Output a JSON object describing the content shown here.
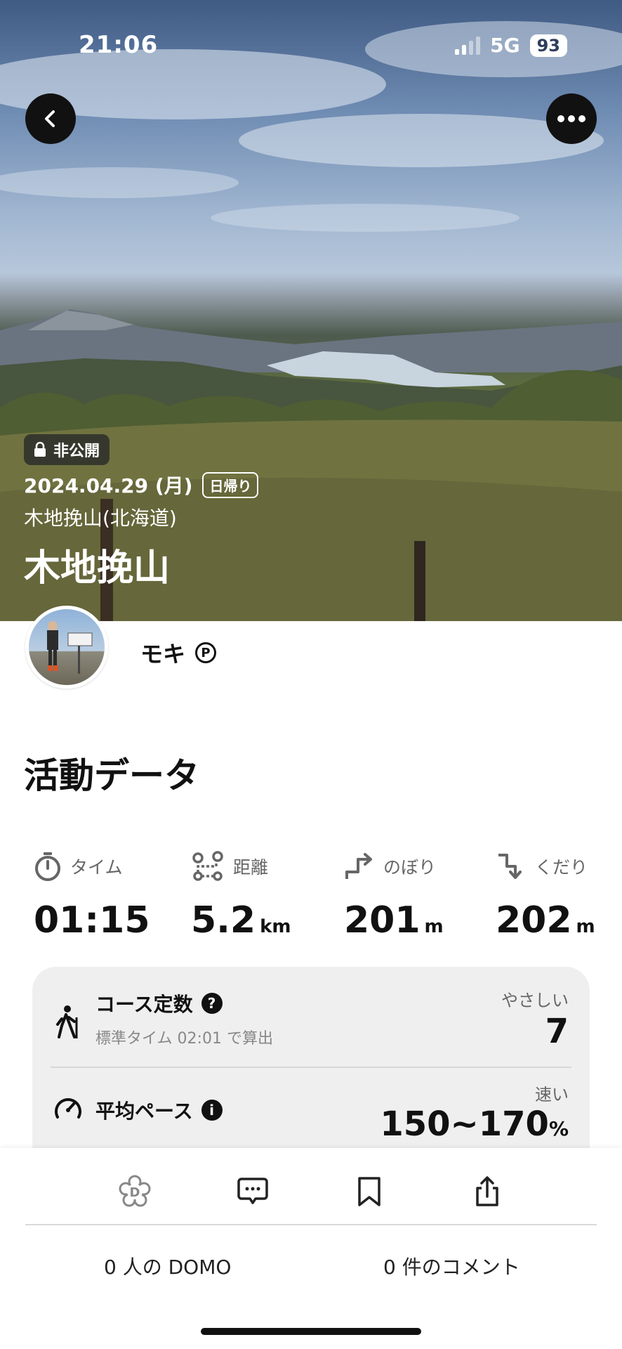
{
  "status_bar": {
    "time": "21:06",
    "network": "5G",
    "battery": "93"
  },
  "hero": {
    "privacy_label": "非公開",
    "date": "2024.04.29 (月)",
    "trip_type": "日帰り",
    "place": "木地挽山(北海道)",
    "title": "木地挽山"
  },
  "user": {
    "name": "モキ",
    "badge": "P"
  },
  "activity": {
    "section_title": "活動データ",
    "stats": [
      {
        "label": "タイム",
        "value": "01:15",
        "unit": "",
        "icon": "stopwatch-icon"
      },
      {
        "label": "距離",
        "value": "5.2",
        "unit": "km",
        "icon": "route-icon"
      },
      {
        "label": "のぼり",
        "value": "201",
        "unit": "m",
        "icon": "ascent-icon"
      },
      {
        "label": "くだり",
        "value": "202",
        "unit": "m",
        "icon": "descent-icon"
      }
    ]
  },
  "course": {
    "title": "コース定数",
    "help": "?",
    "sub": "標準タイム 02:01 で算出",
    "level_label": "やさしい",
    "value": "7"
  },
  "pace": {
    "title": "平均ペース",
    "info": "i",
    "level_label": "速い",
    "value": "150~170",
    "unit": "%"
  },
  "footer": {
    "domo_count": "0 人の DOMO",
    "comment_count": "0 件のコメント"
  }
}
